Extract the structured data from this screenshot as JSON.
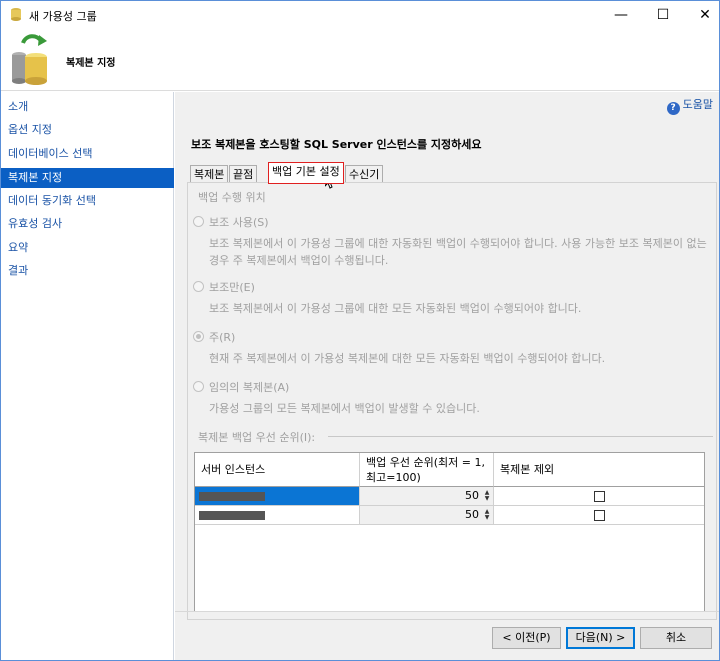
{
  "window": {
    "title": "새 가용성 그룹",
    "controls": {
      "minimize": "—",
      "maximize": "☐",
      "close": "✕"
    }
  },
  "header": {
    "title": "복제본 지정"
  },
  "sidebar": {
    "items": [
      {
        "label": "소개"
      },
      {
        "label": "옵션 지정"
      },
      {
        "label": "데이터베이스 선택"
      },
      {
        "label": "복제본 지정",
        "active": true
      },
      {
        "label": "데이터 동기화 선택"
      },
      {
        "label": "유효성 검사"
      },
      {
        "label": "요약"
      },
      {
        "label": "결과"
      }
    ]
  },
  "help": {
    "label": "도움말"
  },
  "main": {
    "instruction": "보조 복제본을 호스팅할 SQL Server 인스턴스를 지정하세요",
    "tabs": [
      {
        "label": "복제본"
      },
      {
        "label": "끝점"
      },
      {
        "label": "백업 기본 설정",
        "selected": true
      },
      {
        "label": "수신기"
      }
    ],
    "backup": {
      "section_title": "백업 수행 위치",
      "options": [
        {
          "label": "보조 사용(S)",
          "desc": "보조 복제본에서 이 가용성 그룹에 대한 자동화된 백업이 수행되어야 합니다. 사용 가능한 보조 복제본이 없는 경우 주 복제본에서 백업이 수행됩니다."
        },
        {
          "label": "보조만(E)",
          "desc": "보조 복제본에서 이 가용성 그룹에 대한 모든 자동화된 백업이 수행되어야 합니다."
        },
        {
          "label": "주(R)",
          "desc": "현재 주 복제본에서 이 가용성 복제본에 대한 모든 자동화된 백업이 수행되어야 합니다.",
          "checked": true
        },
        {
          "label": "임의의 복제본(A)",
          "desc": "가용성 그룹의 모든 복제본에서 백업이 발생할 수 있습니다."
        }
      ],
      "grid_label": "복제본 백업 우선 순위(I):",
      "grid": {
        "columns": [
          "서버 인스턴스",
          "백업 우선 순위(최저 = 1, 최고=100)",
          "복제본 제외"
        ],
        "rows": [
          {
            "priority": "50",
            "excluded": false
          },
          {
            "priority": "50",
            "excluded": false
          }
        ]
      }
    }
  },
  "footer": {
    "prev": "< 이전(P)",
    "next": "다음(N) >",
    "cancel": "취소"
  },
  "colors": {
    "accent": "#0b5fc4",
    "tab_highlight": "#e02020",
    "link": "#1a53a6"
  }
}
